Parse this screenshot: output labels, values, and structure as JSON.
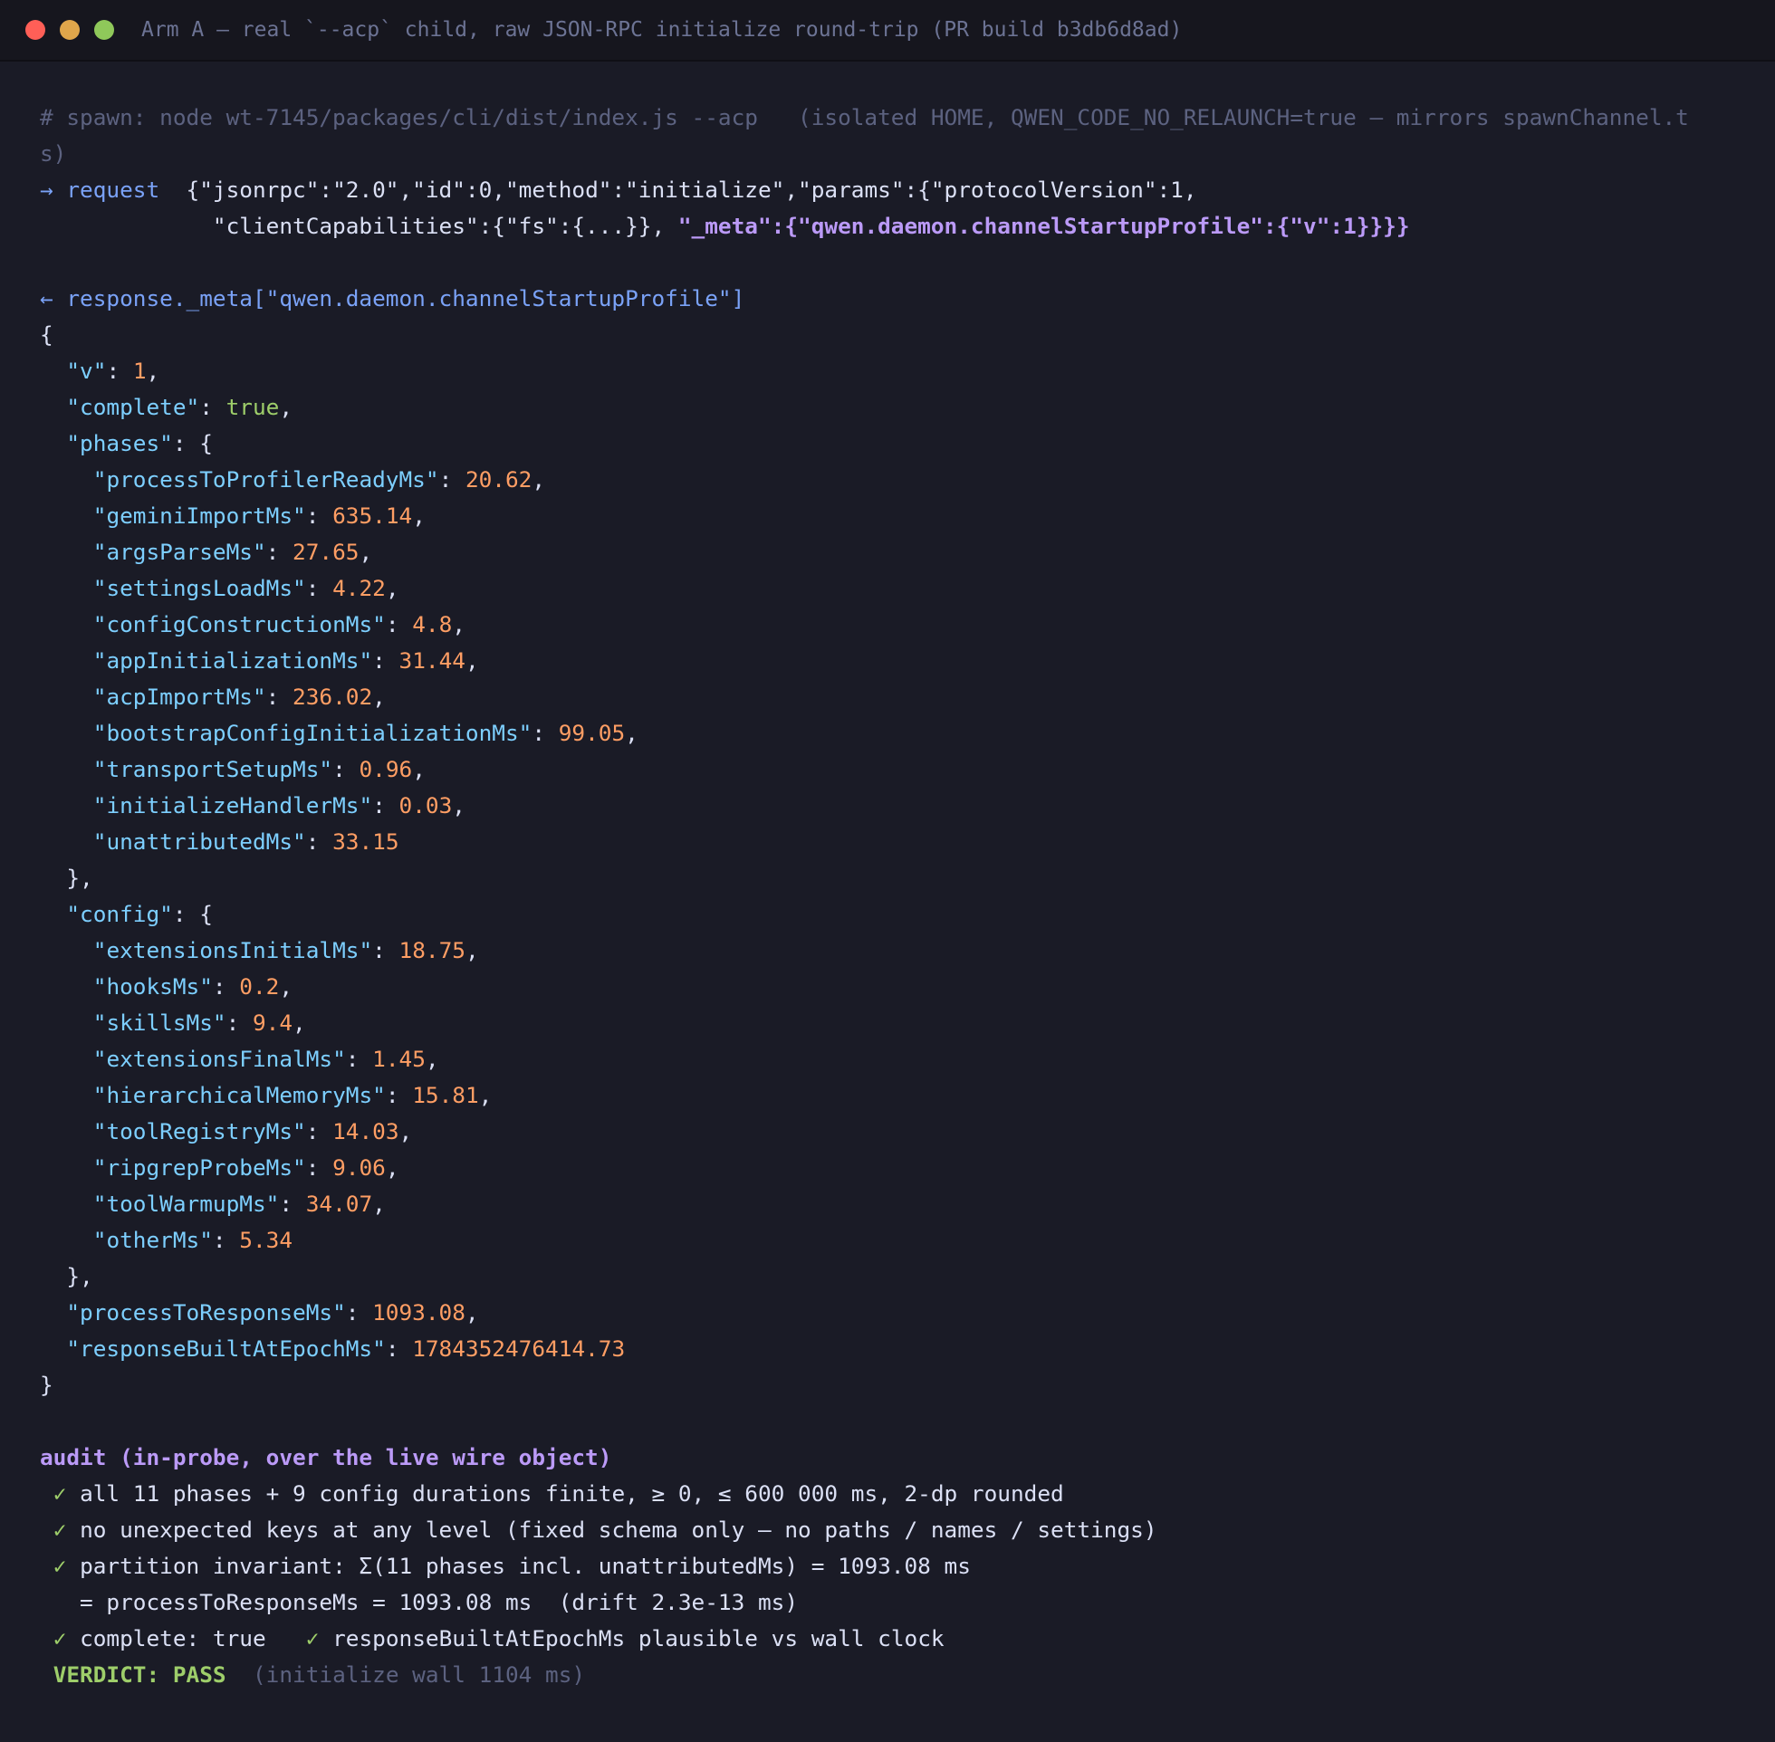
{
  "window": {
    "title": "Arm A — real `--acp` child, raw JSON-RPC initialize round-trip (PR build b3db6d8ad)"
  },
  "spawn": {
    "line1": "# spawn: node wt-7145/packages/cli/dist/index.js --acp   (isolated HOME, QWEN_CODE_NO_RELAUNCH=true — mirrors spawnChannel.t",
    "line2": "s)"
  },
  "request": {
    "arrow_label": "→ request",
    "line1": "  {\"jsonrpc\":\"2.0\",\"id\":0,\"method\":\"initialize\",\"params\":{\"protocolVersion\":1,",
    "line2_plain": "             \"clientCapabilities\":{\"fs\":{...}}, ",
    "line2_meta": "\"_meta\":{\"qwen.daemon.channelStartupProfile\":{\"v\":1}}}}"
  },
  "response": {
    "header": "← response._meta[\"qwen.daemon.channelStartupProfile\"]",
    "v": "1",
    "complete": "true",
    "phases": [
      {
        "key": "processToProfilerReadyMs",
        "value": "20.62"
      },
      {
        "key": "geminiImportMs",
        "value": "635.14"
      },
      {
        "key": "argsParseMs",
        "value": "27.65"
      },
      {
        "key": "settingsLoadMs",
        "value": "4.22"
      },
      {
        "key": "configConstructionMs",
        "value": "4.8"
      },
      {
        "key": "appInitializationMs",
        "value": "31.44"
      },
      {
        "key": "acpImportMs",
        "value": "236.02"
      },
      {
        "key": "bootstrapConfigInitializationMs",
        "value": "99.05"
      },
      {
        "key": "transportSetupMs",
        "value": "0.96"
      },
      {
        "key": "initializeHandlerMs",
        "value": "0.03"
      },
      {
        "key": "unattributedMs",
        "value": "33.15"
      }
    ],
    "config": [
      {
        "key": "extensionsInitialMs",
        "value": "18.75"
      },
      {
        "key": "hooksMs",
        "value": "0.2"
      },
      {
        "key": "skillsMs",
        "value": "9.4"
      },
      {
        "key": "extensionsFinalMs",
        "value": "1.45"
      },
      {
        "key": "hierarchicalMemoryMs",
        "value": "15.81"
      },
      {
        "key": "toolRegistryMs",
        "value": "14.03"
      },
      {
        "key": "ripgrepProbeMs",
        "value": "9.06"
      },
      {
        "key": "toolWarmupMs",
        "value": "34.07"
      },
      {
        "key": "otherMs",
        "value": "5.34"
      }
    ],
    "processToResponseMs": "1093.08",
    "responseBuiltAtEpochMs": "1784352476414.73"
  },
  "audit": {
    "header": "audit (in-probe, over the live wire object)",
    "check1": "all 11 phases + 9 config durations finite, ≥ 0, ≤ 600 000 ms, 2-dp rounded",
    "check2": "no unexpected keys at any level (fixed schema only — no paths / names / settings)",
    "check3": "partition invariant: Σ(11 phases incl. unattributedMs) = 1093.08 ms",
    "check3_cont": "   = processToResponseMs = 1093.08 ms  (drift 2.3e-13 ms)",
    "check4a": "complete: true",
    "check4b": "responseBuiltAtEpochMs plausible vs wall clock",
    "check_mark": "✓",
    "verdict": "VERDICT: PASS",
    "verdict_note": "(initialize wall 1104 ms)"
  }
}
